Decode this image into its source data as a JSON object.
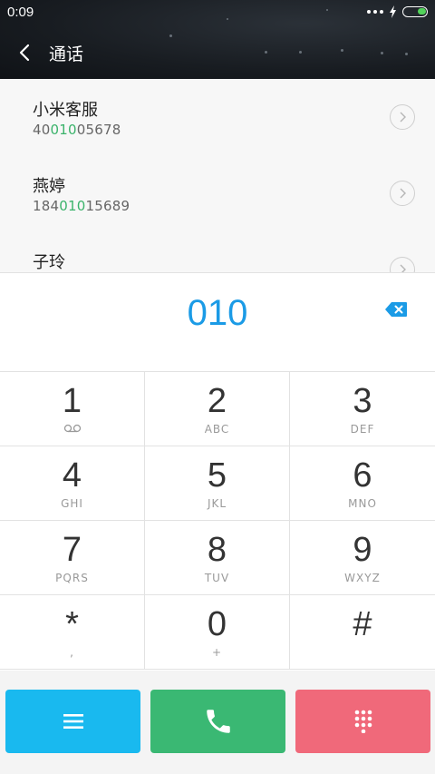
{
  "status": {
    "time": "0:09"
  },
  "header": {
    "title": "通话"
  },
  "suggestions": [
    {
      "name": "小米客服",
      "num_pre": "40",
      "num_match": "010",
      "num_post": "05678"
    },
    {
      "name": "燕婷",
      "num_pre": "184",
      "num_match": "010",
      "num_post": "15689"
    },
    {
      "name": "子玲",
      "num_pre": "",
      "num_match": "",
      "num_post": ""
    }
  ],
  "display": {
    "digits": "010"
  },
  "keypad": [
    {
      "digit": "1",
      "letters": ""
    },
    {
      "digit": "2",
      "letters": "ABC"
    },
    {
      "digit": "3",
      "letters": "DEF"
    },
    {
      "digit": "4",
      "letters": "GHI"
    },
    {
      "digit": "5",
      "letters": "JKL"
    },
    {
      "digit": "6",
      "letters": "MNO"
    },
    {
      "digit": "7",
      "letters": "PQRS"
    },
    {
      "digit": "8",
      "letters": "TUV"
    },
    {
      "digit": "9",
      "letters": "WXYZ"
    },
    {
      "digit": "*",
      "letters": ","
    },
    {
      "digit": "0",
      "letters": "+"
    },
    {
      "digit": "#",
      "letters": ""
    }
  ],
  "icons": {
    "back": "chevron-left-icon",
    "delete": "backspace-icon",
    "voicemail": "voicemail-icon",
    "menu": "menu-icon",
    "call": "phone-icon",
    "dialpad": "dialpad-icon"
  },
  "colors": {
    "accent": "#1b9be6",
    "match": "#3bb36b",
    "menu_button": "#19b9ef",
    "call_button": "#3ab873",
    "dialpad_button": "#f0697a"
  }
}
